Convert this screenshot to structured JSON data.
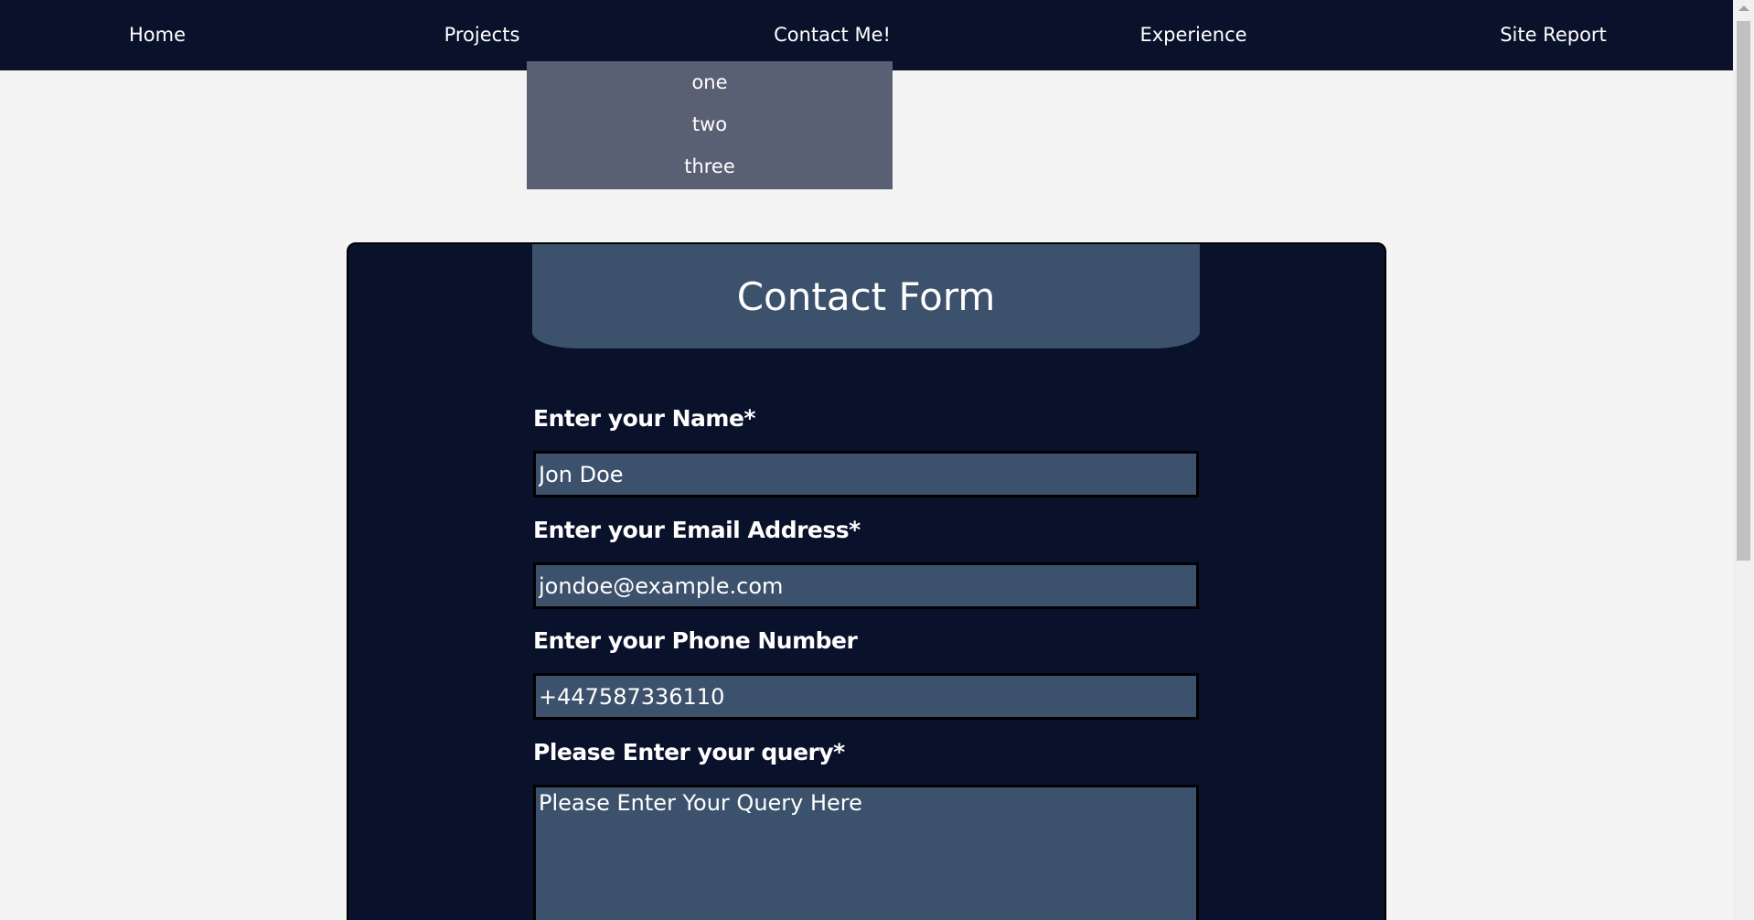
{
  "nav": {
    "home": "Home",
    "projects": "Projects",
    "contact": "Contact Me!",
    "experience": "Experience",
    "site_report": "Site Report"
  },
  "dropdown": {
    "items": [
      "one",
      "two",
      "three"
    ]
  },
  "form": {
    "title": "Contact Form",
    "name_label": "Enter your Name*",
    "name_placeholder": "Jon Doe",
    "email_label": "Enter your Email Address*",
    "email_placeholder": "jondoe@example.com",
    "phone_label": "Enter your Phone Number",
    "phone_placeholder": "+447587336110",
    "query_label": "Please Enter your query*",
    "query_placeholder": "Please Enter Your Query Here"
  },
  "colors": {
    "navbar_bg": "#0a112b",
    "dropdown_bg": "#5a6073",
    "card_bg": "#0a112b",
    "field_bg": "#3c516c",
    "page_bg": "#f4f4f4"
  }
}
